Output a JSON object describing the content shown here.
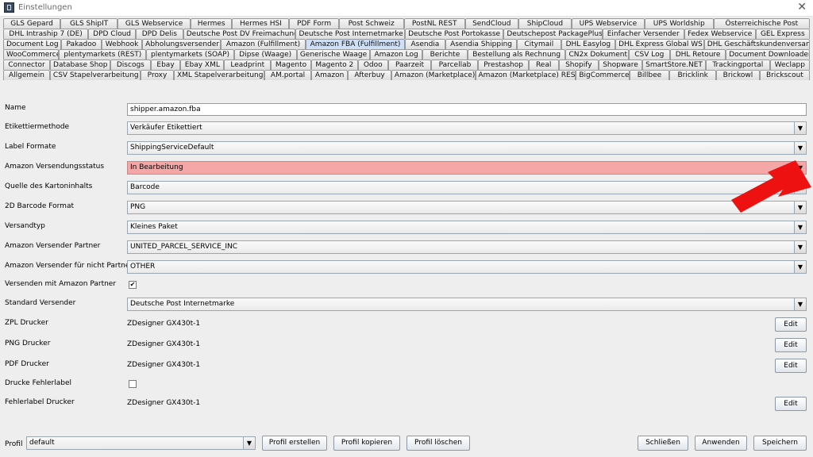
{
  "window": {
    "title": "Einstellungen",
    "close": "✕"
  },
  "tabs": {
    "rows": [
      [
        "GLS Gepard",
        "GLS ShipIT",
        "GLS Webservice",
        "Hermes",
        "Hermes HSI",
        "PDF Form",
        "Post Schweiz",
        "PostNL REST",
        "SendCloud",
        "ShipCloud",
        "UPS Webservice",
        "UPS Worldship",
        "Österreichische Post"
      ],
      [
        "DHL Intraship 7 (DE)",
        "DPD Cloud",
        "DPD Delis",
        "Deutsche Post DV Freimachung",
        "Deutsche Post Internetmarke",
        "Deutsche Post Portokasse",
        "Deutschepost PackagePlus",
        "Einfacher Versender",
        "Fedex Webservice",
        "GEL Express"
      ],
      [
        "Document Log",
        "Pakadoo",
        "Webhook",
        "Abholungsversender",
        "Amazon (Fulfillment)",
        "Amazon FBA (Fulfillment)",
        "Asendia",
        "Asendia Shipping",
        "Citymail",
        "DHL Easylog",
        "DHL Express Global WS",
        "DHL Geschäftskundenversand"
      ],
      [
        "WooCommerce",
        "plentymarkets (REST)",
        "plentymarkets (SOAP)",
        "Dipse (Waage)",
        "Generische Waage",
        "Amazon Log",
        "Berichte",
        "Bestellung als Rechnung",
        "CN2x Dokument",
        "CSV Log",
        "DHL Retoure",
        "Document Downloader"
      ],
      [
        "Connector",
        "Database Shop",
        "Discogs",
        "Ebay",
        "Ebay XML",
        "Leadprint",
        "Magento",
        "Magento 2",
        "Odoo",
        "Paarzeit",
        "Parcellab",
        "Prestashop",
        "Real",
        "Shopify",
        "Shopware",
        "SmartStore.NET",
        "Trackingportal",
        "Weclapp"
      ],
      [
        "Allgemein",
        "CSV Stapelverarbeitung",
        "Proxy",
        "XML Stapelverarbeitung",
        "AM.portal",
        "Amazon",
        "Afterbuy",
        "Amazon (Marketplace)",
        "Amazon (Marketplace) REST",
        "BigCommerce",
        "Billbee",
        "Bricklink",
        "Brickowl",
        "Brickscout"
      ]
    ],
    "active": "Amazon FBA (Fulfillment)"
  },
  "form": {
    "name": {
      "label": "Name",
      "value": "shipper.amazon.fba"
    },
    "etikettiermethode": {
      "label": "Etikettiermethode",
      "value": "Verkäufer Etikettiert"
    },
    "label_formate": {
      "label": "Label Formate",
      "value": "ShippingServiceDefault"
    },
    "versandstatus": {
      "label": "Amazon Versendungsstatus",
      "value": "In Bearbeitung"
    },
    "quelle": {
      "label": "Quelle des Kartoninhalts",
      "value": "Barcode"
    },
    "barcode_format": {
      "label": "2D Barcode Format",
      "value": "PNG"
    },
    "versandtyp": {
      "label": "Versandtyp",
      "value": "Kleines Paket"
    },
    "versender_partner": {
      "label": "Amazon Versender Partner",
      "value": "UNITED_PARCEL_SERVICE_INC"
    },
    "versender_nicht_partner": {
      "label": "Amazon Versender für nicht Partner",
      "value": "OTHER"
    },
    "versenden_partner": {
      "label": "Versenden mit Amazon Partner",
      "checked": "✔"
    },
    "standard_versender": {
      "label": "Standard Versender",
      "value": "Deutsche Post Internetmarke"
    },
    "zpl_drucker": {
      "label": "ZPL Drucker",
      "value": "ZDesigner GX430t-1"
    },
    "png_drucker": {
      "label": "PNG Drucker",
      "value": "ZDesigner GX430t-1"
    },
    "pdf_drucker": {
      "label": "PDF Drucker",
      "value": "ZDesigner GX430t-1"
    },
    "fehlerlabel": {
      "label": "Drucke Fehlerlabel",
      "checked": ""
    },
    "fehlerlabel_drucker": {
      "label": "Fehlerlabel Drucker",
      "value": "ZDesigner GX430t-1"
    },
    "edit_label": "Edit",
    "dropdown_arrow": "▼"
  },
  "footer": {
    "profile_label": "Profil",
    "profile_value": "default",
    "profil_erstellen": "Profil erstellen",
    "profil_kopieren": "Profil kopieren",
    "profil_loeschen": "Profil löschen",
    "schliessen": "Schließen",
    "anwenden": "Anwenden",
    "speichern": "Speichern"
  },
  "colors": {
    "highlight": "#f4a7a6",
    "arrow": "#ee1111",
    "active_tab": "#cfe0f6"
  }
}
